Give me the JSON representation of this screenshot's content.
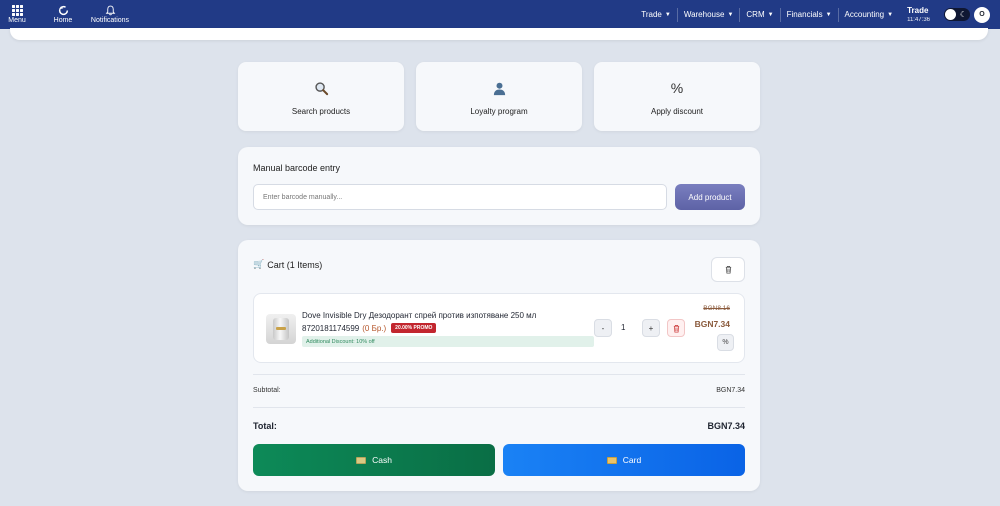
{
  "nav": {
    "menu_label": "Menu",
    "home_label": "Home",
    "notifications_label": "Notifications",
    "links": [
      "Trade",
      "Warehouse",
      "CRM",
      "Financials",
      "Accounting"
    ],
    "module_title": "Trade",
    "time": "11:47:36",
    "avatar_letter": "O"
  },
  "actions": {
    "search_label": "Search products",
    "loyalty_label": "Loyalty program",
    "discount_label": "Apply discount",
    "discount_symbol": "%"
  },
  "barcode": {
    "title": "Manual barcode entry",
    "placeholder": "Enter barcode manually...",
    "add_label": "Add product"
  },
  "cart": {
    "title": "Cart (1 Items)",
    "items": [
      {
        "name": "Dove Invisible Dry Дезодорант спрей против изпотяване 250 мл",
        "barcode": "8720181174599",
        "stock": "(0 Бр.)",
        "promo": "20.00% PROMO",
        "discount_note": "Additional Discount: 10% off",
        "quantity": "1",
        "old_price": "BGN8.16",
        "price": "BGN7.34",
        "minus_label": "-",
        "plus_label": "+",
        "discount_symbol": "%"
      }
    ],
    "subtotal_label": "Subtotal:",
    "subtotal_value": "BGN7.34",
    "total_label": "Total:",
    "total_value": "BGN7.34",
    "cash_label": "Cash",
    "card_label": "Card"
  }
}
